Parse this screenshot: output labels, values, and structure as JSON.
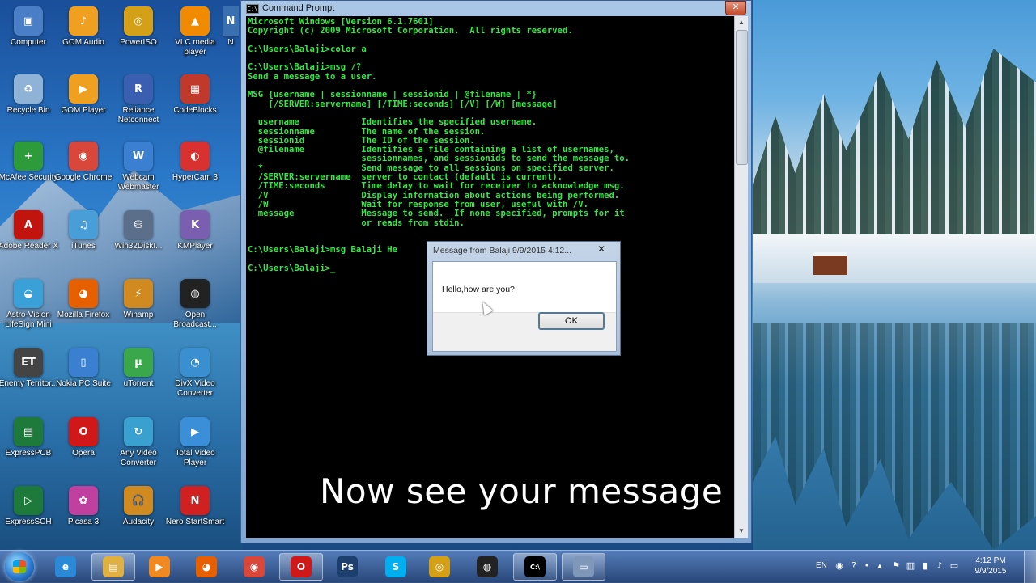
{
  "desktop": {
    "icons": [
      {
        "label": "Computer",
        "glyph": "▣",
        "color": "#4a7fc8",
        "icon": "computer-icon"
      },
      {
        "label": "GOM Audio",
        "glyph": "♪",
        "color": "#f0a020",
        "icon": "gom-audio-icon"
      },
      {
        "label": "PowerISO",
        "glyph": "◎",
        "color": "#d4a017",
        "icon": "poweriso-icon"
      },
      {
        "label": "VLC media player",
        "glyph": "▲",
        "color": "#f08a00",
        "icon": "vlc-icon"
      },
      {
        "label": "N",
        "glyph": "N",
        "color": "#3a6fb0",
        "icon": "partial-icon"
      },
      {
        "label": "Recycle Bin",
        "glyph": "♻",
        "color": "#8fb3d6",
        "icon": "recycle-bin-icon"
      },
      {
        "label": "GOM Player",
        "glyph": "▶",
        "color": "#f0a020",
        "icon": "gom-player-icon"
      },
      {
        "label": "Reliance Netconnect",
        "glyph": "R",
        "color": "#3a5fb0",
        "icon": "reliance-icon"
      },
      {
        "label": "CodeBlocks",
        "glyph": "▦",
        "color": "#c0392b",
        "icon": "codeblocks-icon"
      },
      {
        "label": "McAfee Security",
        "glyph": "+",
        "color": "#2e9b3a",
        "icon": "mcafee-icon"
      },
      {
        "label": "Google Chrome",
        "glyph": "◉",
        "color": "#d9473b",
        "icon": "chrome-icon"
      },
      {
        "label": "Webcam Webmaster",
        "glyph": "W",
        "color": "#3a7fd0",
        "icon": "webcam-icon"
      },
      {
        "label": "HyperCam 3",
        "glyph": "◐",
        "color": "#d93030",
        "icon": "hypercam-icon"
      },
      {
        "label": "Adobe Reader X",
        "glyph": "A",
        "color": "#c2140e",
        "icon": "adobe-reader-icon"
      },
      {
        "label": "iTunes",
        "glyph": "♫",
        "color": "#4a9ed8",
        "icon": "itunes-icon"
      },
      {
        "label": "Win32DiskI...",
        "glyph": "⛁",
        "color": "#5b6f8a",
        "icon": "win32disk-icon"
      },
      {
        "label": "KMPlayer",
        "glyph": "K",
        "color": "#7a5fb0",
        "icon": "kmplayer-icon"
      },
      {
        "label": "Astro-Vision LifeSign Mini",
        "glyph": "◒",
        "color": "#3aa0d8",
        "icon": "astro-vision-icon"
      },
      {
        "label": "Mozilla Firefox",
        "glyph": "◕",
        "color": "#e66000",
        "icon": "firefox-icon"
      },
      {
        "label": "Winamp",
        "glyph": "⚡",
        "color": "#d08a20",
        "icon": "winamp-icon"
      },
      {
        "label": "Open Broadcast...",
        "glyph": "◍",
        "color": "#222222",
        "icon": "obs-icon"
      },
      {
        "label": "Enemy Territor...",
        "glyph": "ET",
        "color": "#444444",
        "icon": "enemy-territory-icon"
      },
      {
        "label": "Nokia PC Suite",
        "glyph": "▯",
        "color": "#3a7fd0",
        "icon": "nokia-pc-suite-icon"
      },
      {
        "label": "uTorrent",
        "glyph": "µ",
        "color": "#3aa84a",
        "icon": "utorrent-icon"
      },
      {
        "label": "DivX Video Converter",
        "glyph": "◔",
        "color": "#3a8fd0",
        "icon": "divx-icon"
      },
      {
        "label": "ExpressPCB",
        "glyph": "▤",
        "color": "#1e7a3a",
        "icon": "expresspcb-icon"
      },
      {
        "label": "Opera",
        "glyph": "O",
        "color": "#d01818",
        "icon": "opera-icon"
      },
      {
        "label": "Any Video Converter",
        "glyph": "↻",
        "color": "#3aa0d0",
        "icon": "any-video-converter-icon"
      },
      {
        "label": "Total Video Player",
        "glyph": "▶",
        "color": "#3a8fd8",
        "icon": "total-video-player-icon"
      },
      {
        "label": "ExpressSCH",
        "glyph": "▷",
        "color": "#1e7a3a",
        "icon": "expresssch-icon"
      },
      {
        "label": "Picasa 3",
        "glyph": "✿",
        "color": "#c040a0",
        "icon": "picasa-icon"
      },
      {
        "label": "Audacity",
        "glyph": "🎧",
        "color": "#d08a20",
        "icon": "audacity-icon"
      },
      {
        "label": "Nero StartSmart",
        "glyph": "N",
        "color": "#d02020",
        "icon": "nero-icon"
      }
    ]
  },
  "cmd": {
    "title": "Command Prompt",
    "close_glyph": "✕",
    "text_color": "#37e646",
    "lines": [
      "Microsoft Windows [Version 6.1.7601]",
      "Copyright (c) 2009 Microsoft Corporation.  All rights reserved.",
      "",
      "C:\\Users\\Balaji>color a",
      "",
      "C:\\Users\\Balaji>msg /?",
      "Send a message to a user.",
      "",
      "MSG {username | sessionname | sessionid | @filename | *}",
      "    [/SERVER:servername] [/TIME:seconds] [/V] [/W] [message]",
      "",
      "  username            Identifies the specified username.",
      "  sessionname         The name of the session.",
      "  sessionid           The ID of the session.",
      "  @filename           Identifies a file containing a list of usernames,",
      "                      sessionnames, and sessionids to send the message to.",
      "  *                   Send message to all sessions on specified server.",
      "  /SERVER:servername  server to contact (default is current).",
      "  /TIME:seconds       Time delay to wait for receiver to acknowledge msg.",
      "  /V                  Display information about actions being performed.",
      "  /W                  Wait for response from user, useful with /V.",
      "  message             Message to send.  If none specified, prompts for it",
      "                      or reads from stdin.",
      "",
      "",
      "C:\\Users\\Balaji>msg Balaji He",
      "",
      "C:\\Users\\Balaji>_"
    ]
  },
  "caption": "Now see your message",
  "msgbox": {
    "title": "Message from Balaji 9/9/2015 4:12...",
    "close_glyph": "✕",
    "message": "Hello,how are you?",
    "ok_label": "OK"
  },
  "taskbar": {
    "items": [
      {
        "icon": "internet-explorer-icon",
        "glyph": "e",
        "color": "#2a8ad8",
        "active": false
      },
      {
        "icon": "windows-explorer-icon",
        "glyph": "▤",
        "color": "#e0b040",
        "active": true
      },
      {
        "icon": "media-player-icon",
        "glyph": "▶",
        "color": "#f08a20",
        "active": false
      },
      {
        "icon": "firefox-icon",
        "glyph": "◕",
        "color": "#e66000",
        "active": false
      },
      {
        "icon": "chrome-icon",
        "glyph": "◉",
        "color": "#d9473b",
        "active": false
      },
      {
        "icon": "opera-icon",
        "glyph": "O",
        "color": "#d01818",
        "active": true
      },
      {
        "icon": "photoshop-icon",
        "glyph": "Ps",
        "color": "#1c3f6e",
        "active": false
      },
      {
        "icon": "skype-icon",
        "glyph": "S",
        "color": "#00aff0",
        "active": false
      },
      {
        "icon": "folder-icon",
        "glyph": "◎",
        "color": "#d4a017",
        "active": false
      },
      {
        "icon": "obs-icon",
        "glyph": "◍",
        "color": "#222222",
        "active": false
      },
      {
        "icon": "command-prompt-icon",
        "glyph": "C:\\",
        "color": "#000000",
        "active": true
      },
      {
        "icon": "message-window-icon",
        "glyph": "▭",
        "color": "#7f97b8",
        "active": true
      }
    ],
    "tray": {
      "lang": "EN",
      "time": "4:12 PM",
      "date": "9/9/2015"
    }
  }
}
